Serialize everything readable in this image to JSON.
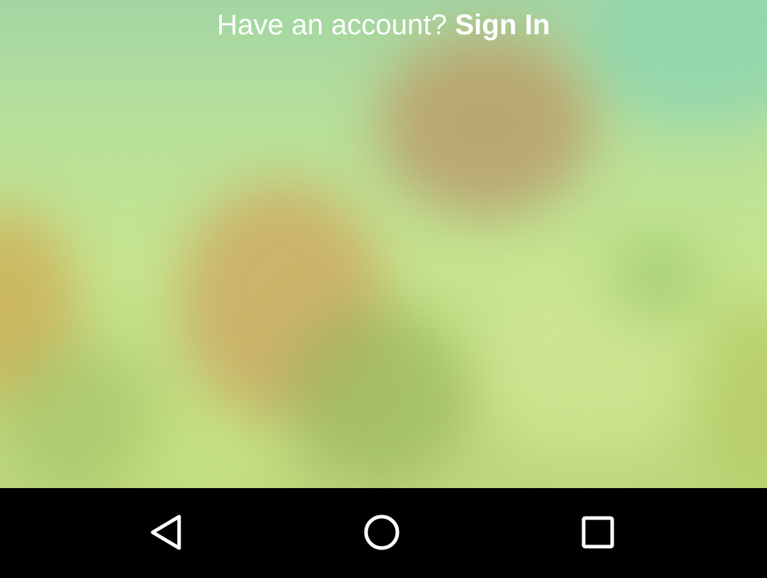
{
  "signin_prompt": {
    "question": "Have an account?",
    "link_label": "Sign In"
  },
  "nav_bar": {
    "back_icon": "back-triangle-icon",
    "home_icon": "home-circle-icon",
    "recents_icon": "recents-square-icon"
  },
  "colors": {
    "prompt_text": "#ffffff",
    "nav_background": "#000000",
    "nav_icon": "#ffffff"
  }
}
